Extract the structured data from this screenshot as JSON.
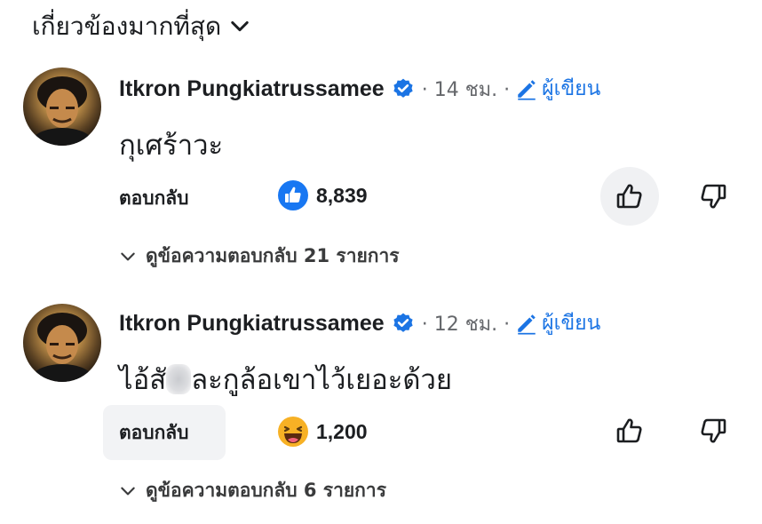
{
  "sort": {
    "label": "เกี่ยวข้องมากที่สุด",
    "icon": "chevron-down-icon"
  },
  "comments": [
    {
      "author": "Itkron Pungkiatrussamee",
      "time_text": "· 14 ชม. ·",
      "author_badge": "ผู้เขียน",
      "text": "กุเศร้าวะ",
      "reply_label": "ตอบกลับ",
      "reaction_icon": "like-reaction-icon",
      "reaction_count": "8,839",
      "view_replies": "ดูข้อความตอบกลับ 21 รายการ"
    },
    {
      "author": "Itkron Pungkiatrussamee",
      "time_text": "· 12 ชม. ·",
      "author_badge": "ผู้เขียน",
      "text_before": "ไอ้สั",
      "text_after": "ละกูล้อเขาไว้เยอะด้วย",
      "reply_label": "ตอบกลับ",
      "reaction_icon": "haha-reaction-icon",
      "reaction_count": "1,200",
      "view_replies": "ดูข้อความตอบกลับ 6 รายการ"
    }
  ],
  "colors": {
    "accent": "#1b74e4",
    "muted": "#65676b",
    "text": "#1c1e21",
    "haha": "#f7b125"
  }
}
